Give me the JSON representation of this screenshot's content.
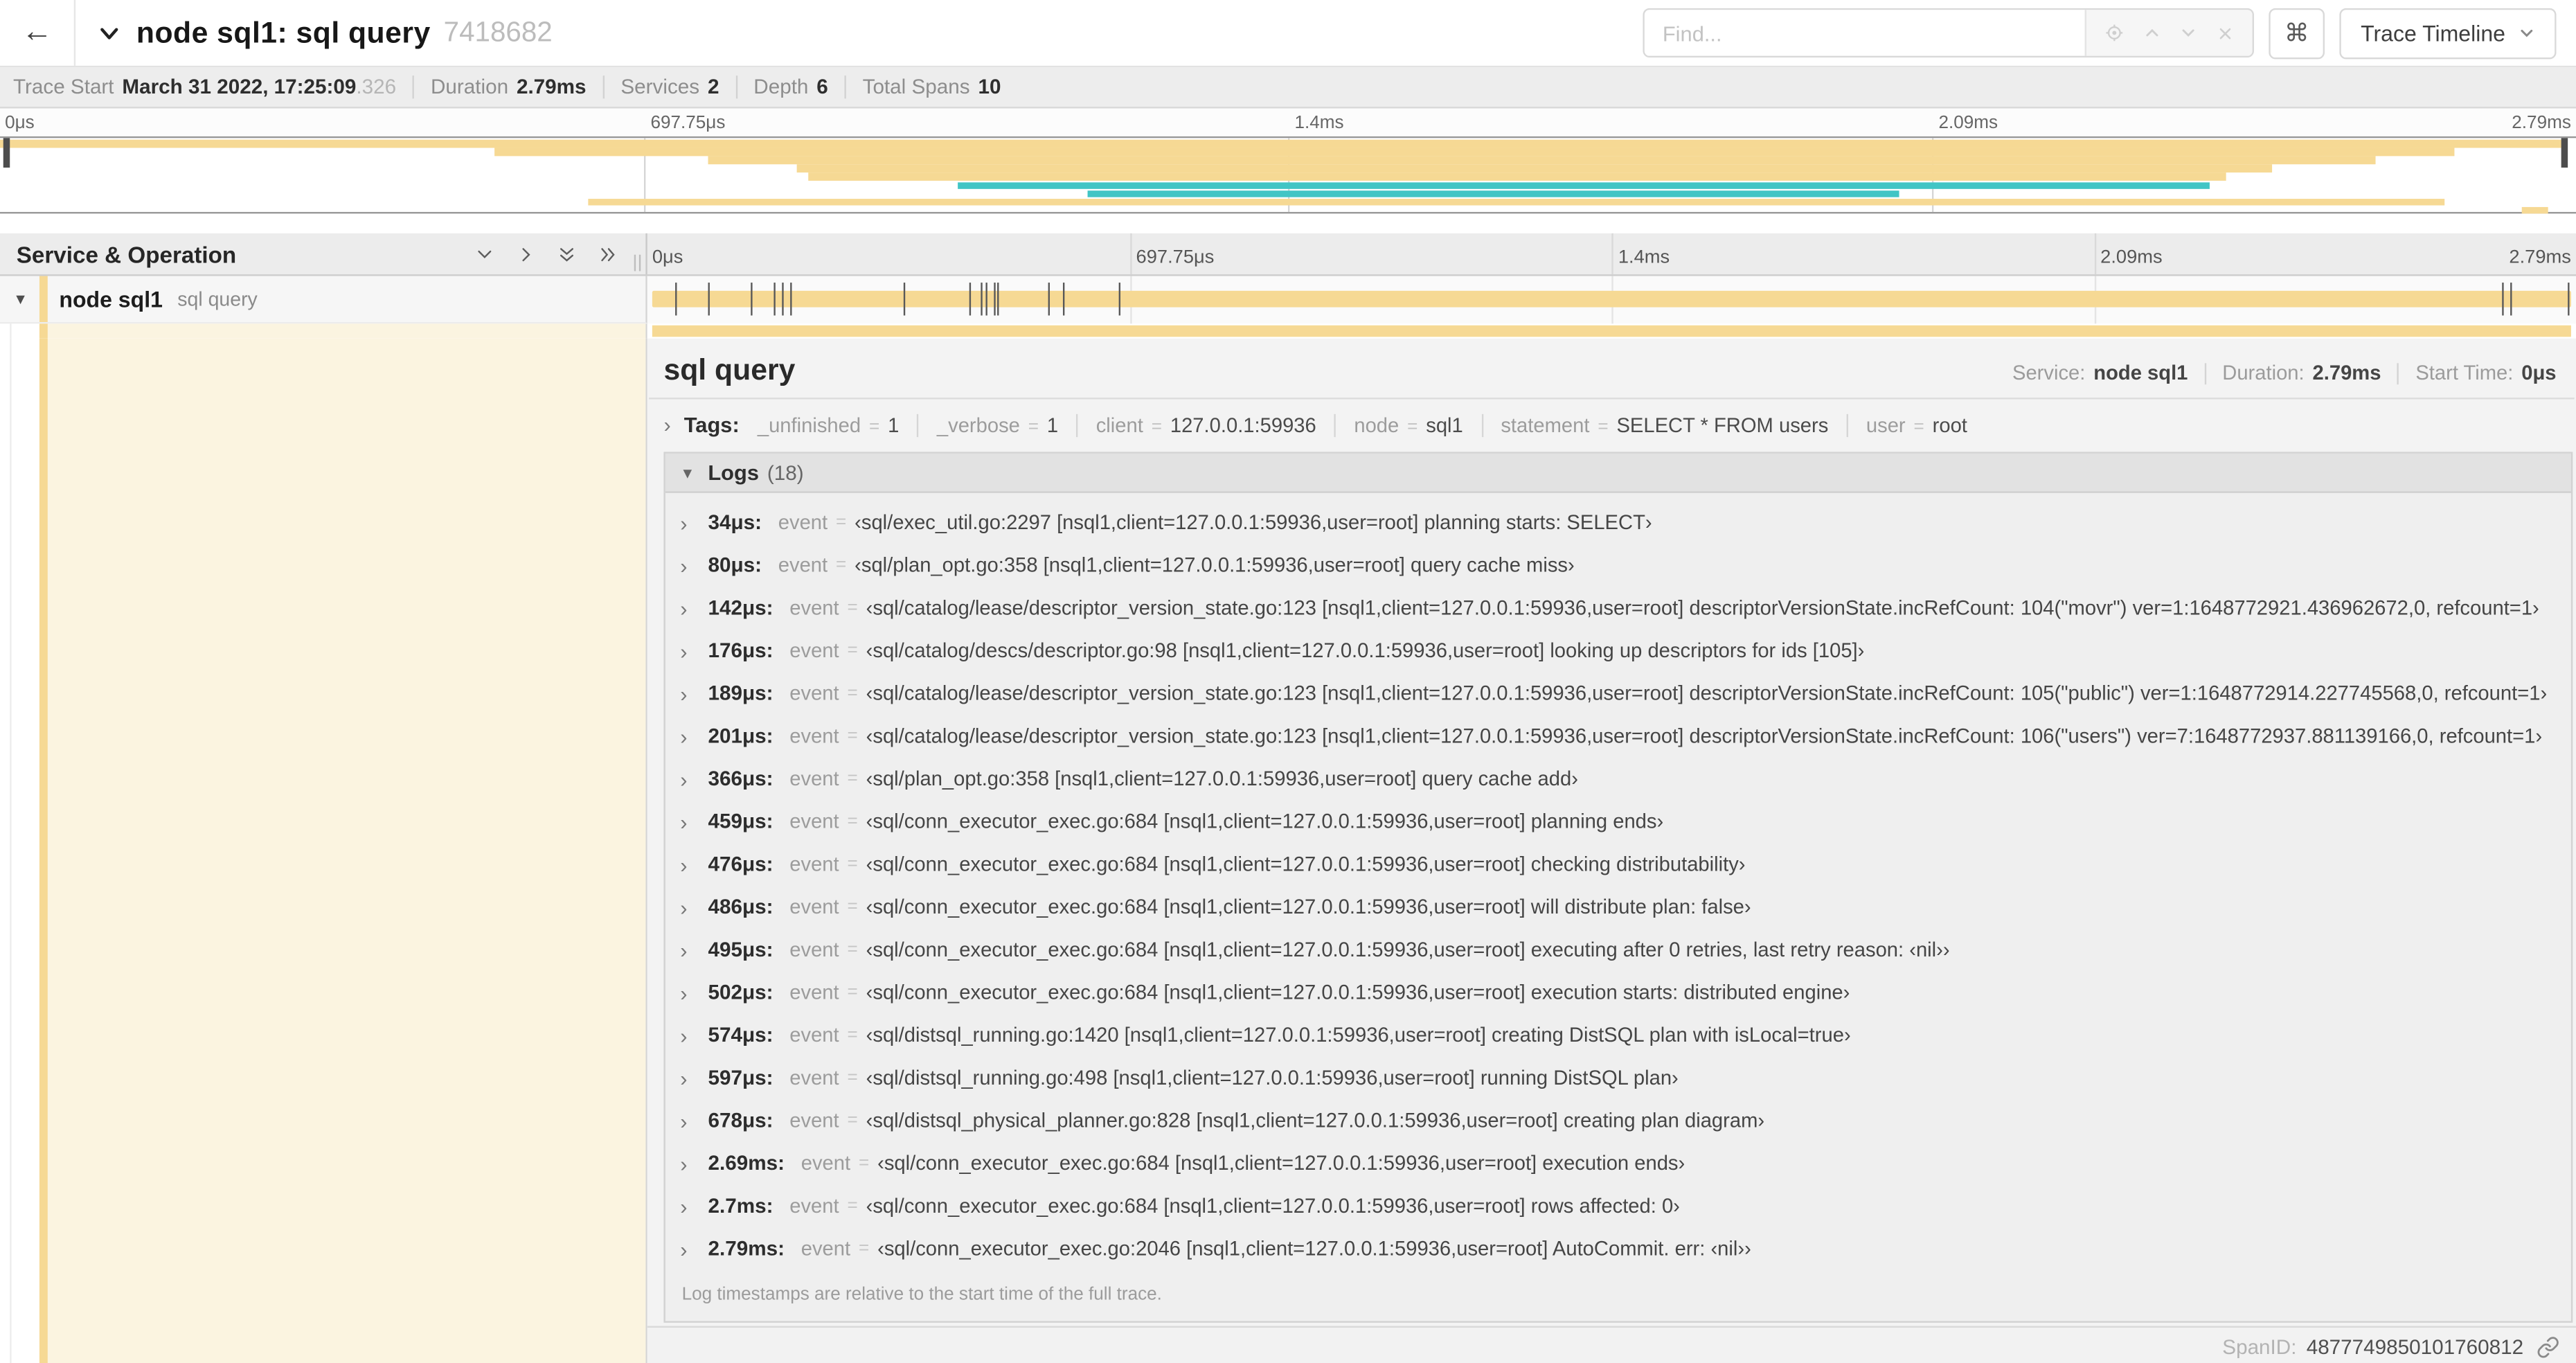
{
  "header": {
    "back_label": "←",
    "title": "node sql1: sql query",
    "trace_id": "7418682",
    "find_placeholder": "Find...",
    "shortcut_key": "⌘",
    "view_selector": "Trace Timeline"
  },
  "trace_info": {
    "items": [
      {
        "label": "Trace Start",
        "value": "March 31 2022, 17:25:09",
        "suffix": ".326"
      },
      {
        "label": "Duration",
        "value": "2.79ms",
        "suffix": ""
      },
      {
        "label": "Services",
        "value": "2",
        "suffix": ""
      },
      {
        "label": "Depth",
        "value": "6",
        "suffix": ""
      },
      {
        "label": "Total Spans",
        "value": "10",
        "suffix": ""
      }
    ]
  },
  "timeline": {
    "left_header": "Service & Operation",
    "ticks": [
      "0μs",
      "697.75μs",
      "1.4ms",
      "2.09ms",
      "2.79ms"
    ],
    "row": {
      "service": "node sql1",
      "operation": "sql query"
    },
    "colors": {
      "span_tan": "#f6d994",
      "span_teal": "#41c5c5",
      "detail_cream": "#fbf4e0",
      "marker": "#585858"
    },
    "minimap_spans": [
      {
        "row": 0,
        "start": 0,
        "end": 99.5,
        "color": "#f6d994"
      },
      {
        "row": 1,
        "start": 19.2,
        "end": 95.3,
        "color": "#f6d994"
      },
      {
        "row": 2,
        "start": 27.5,
        "end": 92.2,
        "color": "#f6d994"
      },
      {
        "row": 3,
        "start": 30.9,
        "end": 88.2,
        "color": "#f6d994"
      },
      {
        "row": 4,
        "start": 31.4,
        "end": 86.4,
        "color": "#f6d994"
      },
      {
        "row": 5,
        "start": 37.2,
        "end": 85.8,
        "color": "#41c5c5"
      },
      {
        "row": 6,
        "start": 42.2,
        "end": 73.7,
        "color": "#41c5c5"
      },
      {
        "row": 7,
        "start": 22.8,
        "end": 94.9,
        "color": "#f6d994"
      },
      {
        "row": 8,
        "start": 97.9,
        "end": 98.9,
        "color": "#f6d994"
      }
    ],
    "log_marker_percents": [
      1.2,
      2.9,
      5.1,
      6.3,
      6.8,
      7.2,
      13.1,
      16.5,
      17.1,
      17.4,
      17.8,
      18.0,
      20.6,
      21.4,
      24.3,
      96.4,
      96.8,
      99.85
    ]
  },
  "detail": {
    "title": "sql query",
    "meta": [
      {
        "label": "Service:",
        "value": "node sql1"
      },
      {
        "label": "Duration:",
        "value": "2.79ms"
      },
      {
        "label": "Start Time:",
        "value": "0μs"
      }
    ],
    "tags_label": "Tags:",
    "tags": [
      {
        "key": "_unfinished",
        "value": "1"
      },
      {
        "key": "_verbose",
        "value": "1"
      },
      {
        "key": "client",
        "value": "127.0.0.1:59936"
      },
      {
        "key": "node",
        "value": "sql1"
      },
      {
        "key": "statement",
        "value": "SELECT * FROM users"
      },
      {
        "key": "user",
        "value": "root"
      }
    ],
    "logs_label": "Logs",
    "logs_count": "(18)",
    "logs": [
      {
        "time": "34μs:",
        "key": "event",
        "value": "‹sql/exec_util.go:2297 [nsql1,client=127.0.0.1:59936,user=root] planning starts: SELECT›"
      },
      {
        "time": "80μs:",
        "key": "event",
        "value": "‹sql/plan_opt.go:358 [nsql1,client=127.0.0.1:59936,user=root] query cache miss›"
      },
      {
        "time": "142μs:",
        "key": "event",
        "value": "‹sql/catalog/lease/descriptor_version_state.go:123 [nsql1,client=127.0.0.1:59936,user=root] descriptorVersionState.incRefCount: 104(\"movr\") ver=1:1648772921.436962672,0, refcount=1›"
      },
      {
        "time": "176μs:",
        "key": "event",
        "value": "‹sql/catalog/descs/descriptor.go:98 [nsql1,client=127.0.0.1:59936,user=root] looking up descriptors for ids [105]›"
      },
      {
        "time": "189μs:",
        "key": "event",
        "value": "‹sql/catalog/lease/descriptor_version_state.go:123 [nsql1,client=127.0.0.1:59936,user=root] descriptorVersionState.incRefCount: 105(\"public\") ver=1:1648772914.227745568,0, refcount=1›"
      },
      {
        "time": "201μs:",
        "key": "event",
        "value": "‹sql/catalog/lease/descriptor_version_state.go:123 [nsql1,client=127.0.0.1:59936,user=root] descriptorVersionState.incRefCount: 106(\"users\") ver=7:1648772937.881139166,0, refcount=1›"
      },
      {
        "time": "366μs:",
        "key": "event",
        "value": "‹sql/plan_opt.go:358 [nsql1,client=127.0.0.1:59936,user=root] query cache add›"
      },
      {
        "time": "459μs:",
        "key": "event",
        "value": "‹sql/conn_executor_exec.go:684 [nsql1,client=127.0.0.1:59936,user=root] planning ends›"
      },
      {
        "time": "476μs:",
        "key": "event",
        "value": "‹sql/conn_executor_exec.go:684 [nsql1,client=127.0.0.1:59936,user=root] checking distributability›"
      },
      {
        "time": "486μs:",
        "key": "event",
        "value": "‹sql/conn_executor_exec.go:684 [nsql1,client=127.0.0.1:59936,user=root] will distribute plan: false›"
      },
      {
        "time": "495μs:",
        "key": "event",
        "value": "‹sql/conn_executor_exec.go:684 [nsql1,client=127.0.0.1:59936,user=root] executing after 0 retries, last retry reason: ‹nil››"
      },
      {
        "time": "502μs:",
        "key": "event",
        "value": "‹sql/conn_executor_exec.go:684 [nsql1,client=127.0.0.1:59936,user=root] execution starts: distributed engine›"
      },
      {
        "time": "574μs:",
        "key": "event",
        "value": "‹sql/distsql_running.go:1420 [nsql1,client=127.0.0.1:59936,user=root] creating DistSQL plan with isLocal=true›"
      },
      {
        "time": "597μs:",
        "key": "event",
        "value": "‹sql/distsql_running.go:498 [nsql1,client=127.0.0.1:59936,user=root] running DistSQL plan›"
      },
      {
        "time": "678μs:",
        "key": "event",
        "value": "‹sql/distsql_physical_planner.go:828 [nsql1,client=127.0.0.1:59936,user=root] creating plan diagram›"
      },
      {
        "time": "2.69ms:",
        "key": "event",
        "value": "‹sql/conn_executor_exec.go:684 [nsql1,client=127.0.0.1:59936,user=root] execution ends›"
      },
      {
        "time": "2.7ms:",
        "key": "event",
        "value": "‹sql/conn_executor_exec.go:684 [nsql1,client=127.0.0.1:59936,user=root] rows affected: 0›"
      },
      {
        "time": "2.79ms:",
        "key": "event",
        "value": "‹sql/conn_executor_exec.go:2046 [nsql1,client=127.0.0.1:59936,user=root] AutoCommit. err: ‹nil››"
      }
    ],
    "footnote": "Log timestamps are relative to the start time of the full trace.",
    "span_id_label": "SpanID:",
    "span_id": "4877749850101760812"
  }
}
